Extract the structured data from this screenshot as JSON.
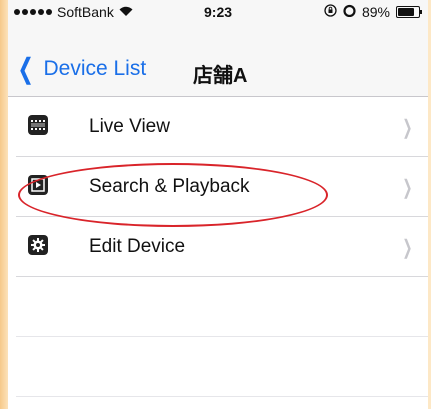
{
  "status": {
    "carrier": "SoftBank",
    "time": "9:23",
    "battery": "89%",
    "battery_level": 0.89
  },
  "nav": {
    "back_label": "Device List",
    "title": "店舗A"
  },
  "menu": [
    {
      "label": "Live View",
      "icon": "film-icon"
    },
    {
      "label": "Search & Playback",
      "icon": "play-icon"
    },
    {
      "label": "Edit Device",
      "icon": "gear-icon"
    }
  ],
  "annotation": {
    "color": "#d9242a",
    "target": "Search & Playback"
  },
  "colors": {
    "accent": "#1a6fe8"
  }
}
